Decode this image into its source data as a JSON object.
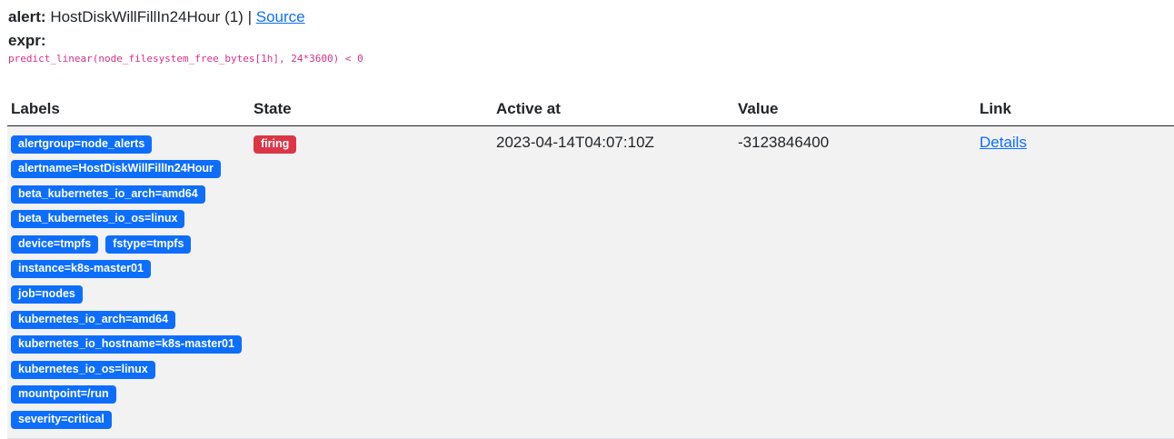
{
  "alert": {
    "label": "alert:",
    "name": "HostDiskWillFillIn24Hour (1)",
    "separator": "|",
    "source_link": "Source"
  },
  "expr": {
    "label": "expr:",
    "code": "predict_linear(node_filesystem_free_bytes[1h], 24*3600) < 0"
  },
  "table": {
    "headers": [
      "Labels",
      "State",
      "Active at",
      "Value",
      "Link"
    ],
    "rows": [
      {
        "labels": [
          "alertgroup=node_alerts",
          "alertname=HostDiskWillFillIn24Hour",
          "beta_kubernetes_io_arch=amd64",
          "beta_kubernetes_io_os=linux",
          "device=tmpfs",
          "fstype=tmpfs",
          "instance=k8s-master01",
          "job=nodes",
          "kubernetes_io_arch=amd64",
          "kubernetes_io_hostname=k8s-master01",
          "kubernetes_io_os=linux",
          "mountpoint=/run",
          "severity=critical"
        ],
        "state": "firing",
        "active_at": "2023-04-14T04:07:10Z",
        "value": "-3123846400",
        "link": "Details"
      }
    ]
  },
  "colors": {
    "label_badge": "#0d6efd",
    "state_badge": "#dc3545",
    "link": "#0d6efd",
    "code": "#d63384",
    "row_background": "#f2f2f2"
  }
}
